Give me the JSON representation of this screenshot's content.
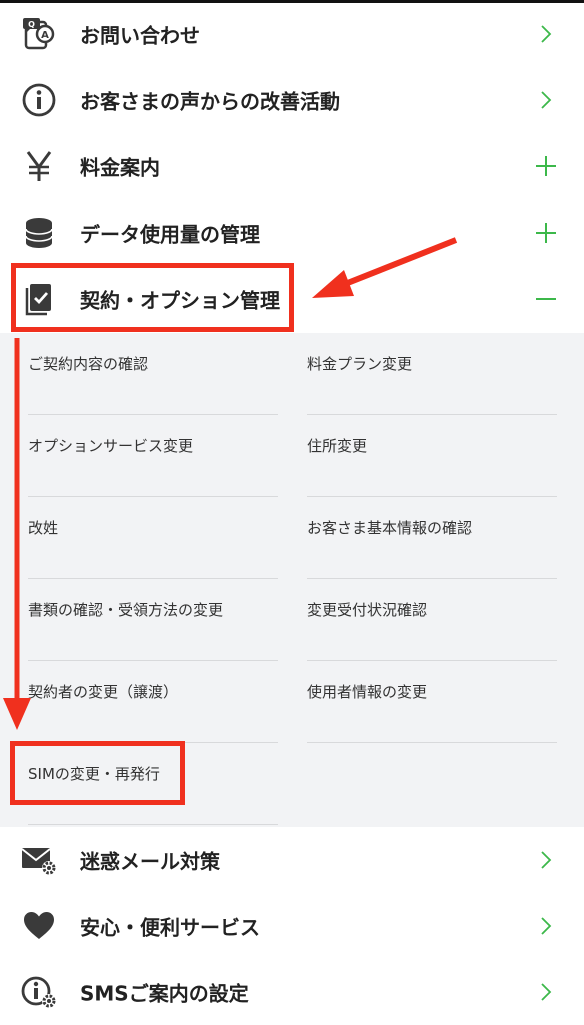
{
  "menu": {
    "contact": {
      "label": "お問い合わせ",
      "icon": "chat-phone-icon",
      "action": "chevron-right-icon"
    },
    "improvement": {
      "label": "お客さまの声からの改善活動",
      "icon": "info-icon",
      "action": "chevron-right-icon"
    },
    "pricing": {
      "label": "料金案内",
      "icon": "yen-icon",
      "action": "plus-icon"
    },
    "data_usage": {
      "label": "データ使用量の管理",
      "icon": "database-icon",
      "action": "plus-icon"
    },
    "contract": {
      "label": "契約・オプション管理",
      "icon": "contract-check-icon",
      "action": "minus-icon"
    },
    "spam": {
      "label": "迷惑メール対策",
      "icon": "mail-gear-icon",
      "action": "chevron-right-icon"
    },
    "safety": {
      "label": "安心・便利サービス",
      "icon": "heart-icon",
      "action": "chevron-right-icon"
    },
    "sms": {
      "label": "SMSご案内の設定",
      "icon": "info-gear-icon",
      "action": "chevron-right-icon"
    }
  },
  "submenu": {
    "items": [
      "ご契約内容の確認",
      "料金プラン変更",
      "オプションサービス変更",
      "住所変更",
      "改姓",
      "お客さま基本情報の確認",
      "書類の確認・受領方法の変更",
      "変更受付状況確認",
      "契約者の変更（譲渡）",
      "使用者情報の変更",
      "SIMの変更・再発行"
    ]
  },
  "colors": {
    "accent_green": "#3cb84a",
    "highlight_red": "#f0301e",
    "panel_bg": "#f2f3f5",
    "icon_dark": "#3a3a3a"
  }
}
